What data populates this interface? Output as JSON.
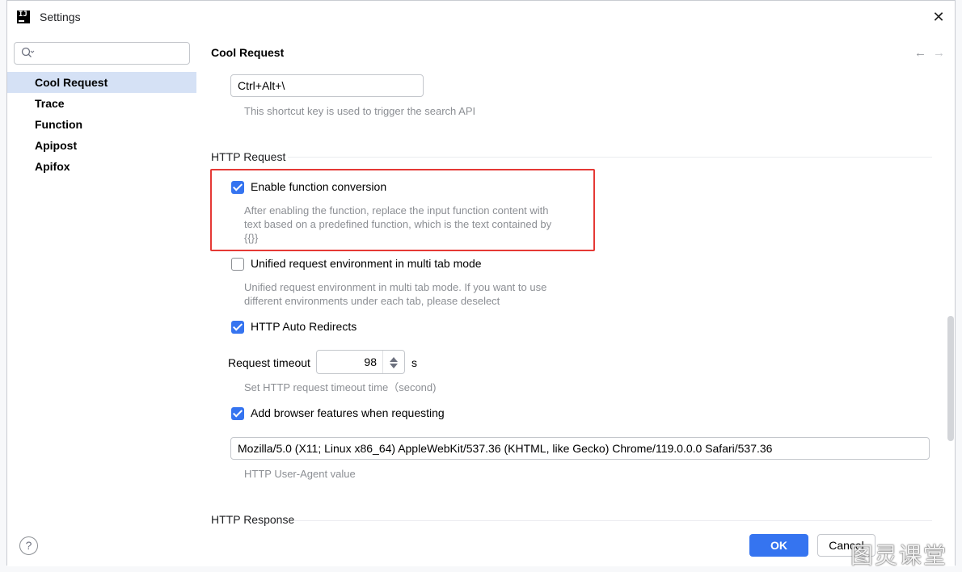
{
  "window": {
    "title": "Settings",
    "app_icon_text": "IJ"
  },
  "sidebar": {
    "search_placeholder": "",
    "items": [
      {
        "label": "Cool Request",
        "active": true
      },
      {
        "label": "Trace"
      },
      {
        "label": "Function"
      },
      {
        "label": "Apipost"
      },
      {
        "label": "Apifox"
      }
    ]
  },
  "main": {
    "title": "Cool Request",
    "nav_back": "←",
    "nav_forward": "→",
    "shortcut_value": "Ctrl+Alt+\\",
    "shortcut_hint": "This shortcut key is used to trigger the search API",
    "http_request_section": "HTTP Request",
    "enable_function_conversion": {
      "label": "Enable function conversion",
      "checked": true
    },
    "function_conversion_hint_line1": "After enabling the function, replace the input function content with",
    "function_conversion_hint_line2": "text based on a predefined function, which is the text contained by",
    "function_conversion_hint_line3": "{{}}",
    "unified_env": {
      "label": "Unified request environment in multi tab mode",
      "checked": false
    },
    "unified_env_hint_line1": "Unified request environment in multi tab mode. If you want to use",
    "unified_env_hint_line2": "different environments under each tab, please deselect",
    "auto_redirects": {
      "label": "HTTP Auto Redirects",
      "checked": true
    },
    "timeout_label": "Request timeout",
    "timeout_value": "98",
    "timeout_unit": "s",
    "timeout_hint": "Set HTTP request timeout time（second)",
    "browser_features": {
      "label": "Add browser features when requesting",
      "checked": true
    },
    "user_agent_value": "Mozilla/5.0 (X11; Linux x86_64) AppleWebKit/537.36 (KHTML, like Gecko) Chrome/119.0.0.0 Safari/537.36",
    "user_agent_hint": "HTTP User-Agent value",
    "http_response_section": "HTTP Response"
  },
  "footer": {
    "help": "?",
    "ok_label": "OK",
    "cancel_label": "Cancel"
  },
  "overlay": {
    "watermark": "图灵课堂"
  },
  "colors": {
    "accent": "#3574f0",
    "highlight_border": "#e53935",
    "selected_nav": "#d5e1f5"
  }
}
